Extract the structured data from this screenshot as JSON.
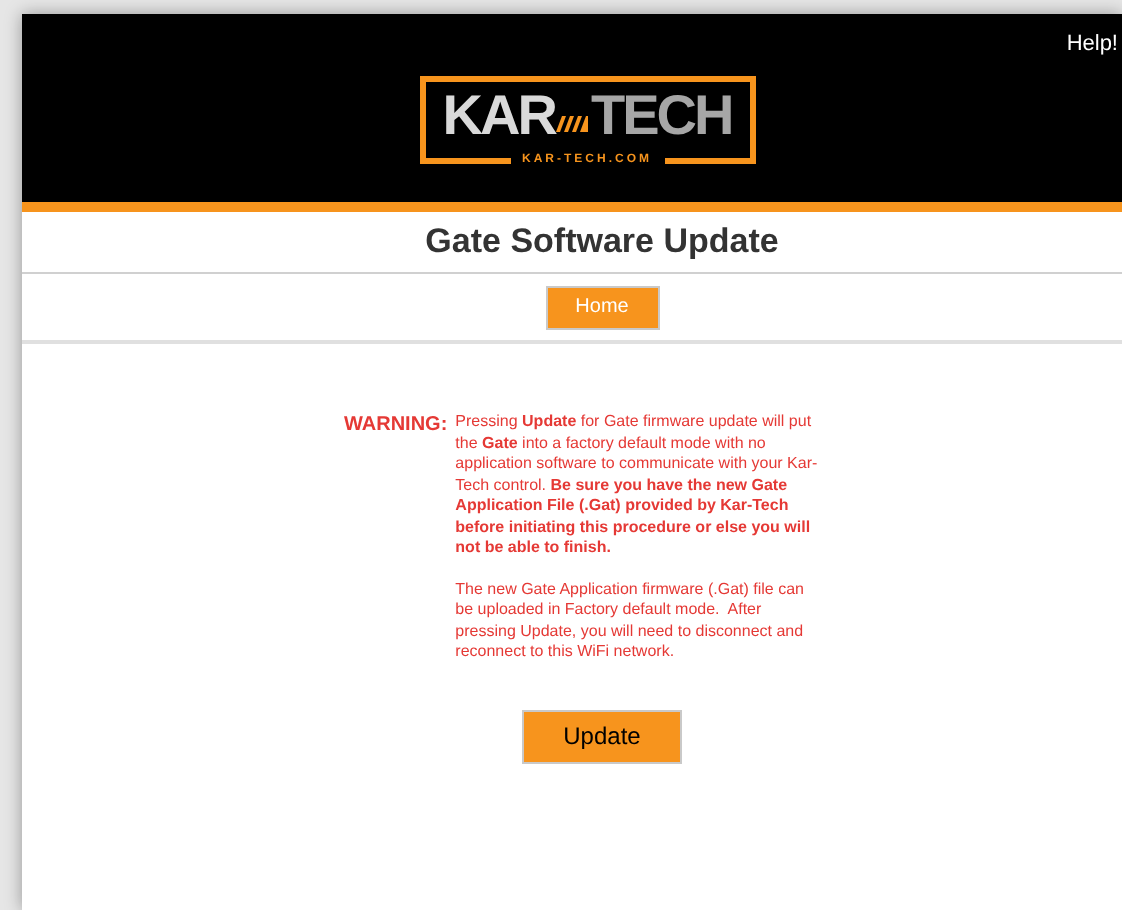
{
  "header": {
    "help_link": "Help!",
    "logo": {
      "left": "KAR",
      "right": "TECH",
      "tagline": "KAR-TECH.COM"
    }
  },
  "title": "Gate Software Update",
  "nav": [
    {
      "label": "Home"
    }
  ],
  "warning": {
    "label": "WARNING:",
    "paragraphs": [
      "Pressing **Update** for Gate firmware update will put the **Gate** into a factory default mode with no application software to communicate with your Kar-Tech control. **Be sure you have the new Gate Application File (.Gat) provided by Kar-Tech before initiating this procedure or else you will not be able to finish.**",
      "The new Gate Application firmware (.Gat) file can be uploaded in Factory default mode.  After pressing Update, you will need to disconnect and reconnect to this WiFi network."
    ]
  },
  "update_button": "Update"
}
